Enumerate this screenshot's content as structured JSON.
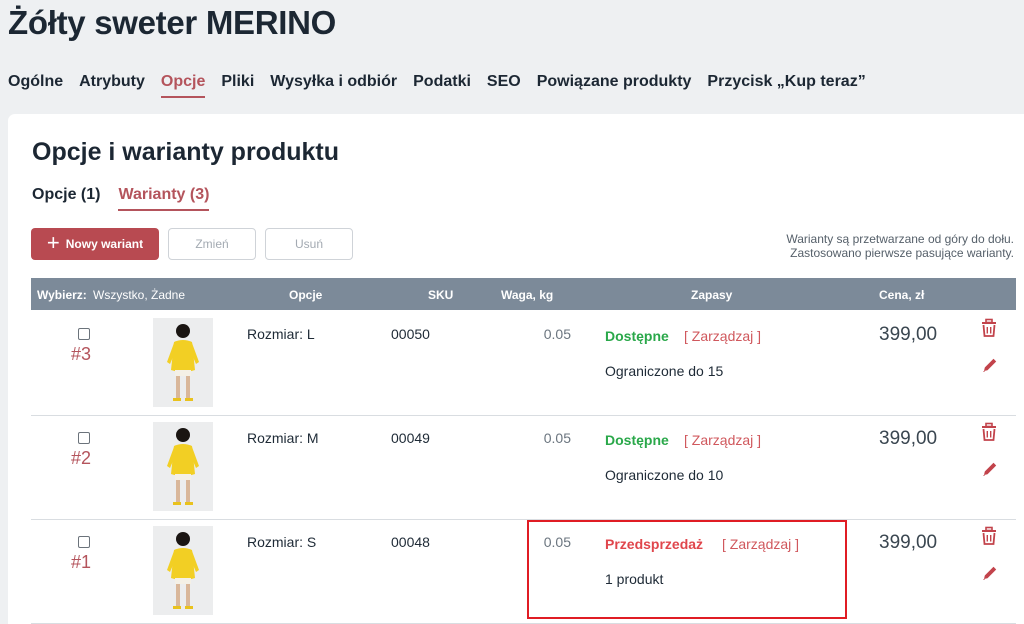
{
  "page": {
    "title": "Żółty sweter MERINO"
  },
  "nav": {
    "tabs": [
      {
        "label": "Ogólne",
        "active": false
      },
      {
        "label": "Atrybuty",
        "active": false
      },
      {
        "label": "Opcje",
        "active": true
      },
      {
        "label": "Pliki",
        "active": false
      },
      {
        "label": "Wysyłka i odbiór",
        "active": false
      },
      {
        "label": "Podatki",
        "active": false
      },
      {
        "label": "SEO",
        "active": false
      },
      {
        "label": "Powiązane produkty",
        "active": false
      },
      {
        "label": "Przycisk „Kup teraz”",
        "active": false
      }
    ]
  },
  "section": {
    "title": "Opcje i warianty produktu"
  },
  "subtabs": [
    {
      "label": "Opcje (1)",
      "active": false
    },
    {
      "label": "Warianty (3)",
      "active": true
    }
  ],
  "toolbar": {
    "new_label": "Nowy wariant",
    "edit_label": "Zmień",
    "delete_label": "Usuń"
  },
  "hint": {
    "line1": "Warianty są przetwarzane od góry do dołu.",
    "line2": "Zastosowano pierwsze pasujące warianty."
  },
  "table": {
    "headers": {
      "select": "Wybierz:",
      "select_links": "Wszystko, Żadne",
      "options": "Opcje",
      "sku": "SKU",
      "weight": "Waga, kg",
      "stock": "Zapasy",
      "price": "Cena, zł"
    },
    "rows": [
      {
        "number": "#3",
        "option": "Rozmiar: L",
        "sku": "00050",
        "weight": "0.05",
        "stock_status": "Dostępne",
        "manage": "[ Zarządzaj ]",
        "stock_note": "Ograniczone do 15",
        "price": "399,00"
      },
      {
        "number": "#2",
        "option": "Rozmiar: M",
        "sku": "00049",
        "weight": "0.05",
        "stock_status": "Dostępne",
        "manage": "[ Zarządzaj ]",
        "stock_note": "Ograniczone do 10",
        "price": "399,00"
      },
      {
        "number": "#1",
        "option": "Rozmiar: S",
        "sku": "00048",
        "weight": "0.05",
        "stock_status": "Przedsprzedaż",
        "manage": "[ Zarządzaj ]",
        "stock_note": "1 produkt",
        "price": "399,00"
      }
    ]
  },
  "colors": {
    "accent": "#b4545c",
    "available": "#2aa84a",
    "preorder": "#e0464c",
    "header_bg": "#7c8a99",
    "highlight": "#e01c24"
  }
}
